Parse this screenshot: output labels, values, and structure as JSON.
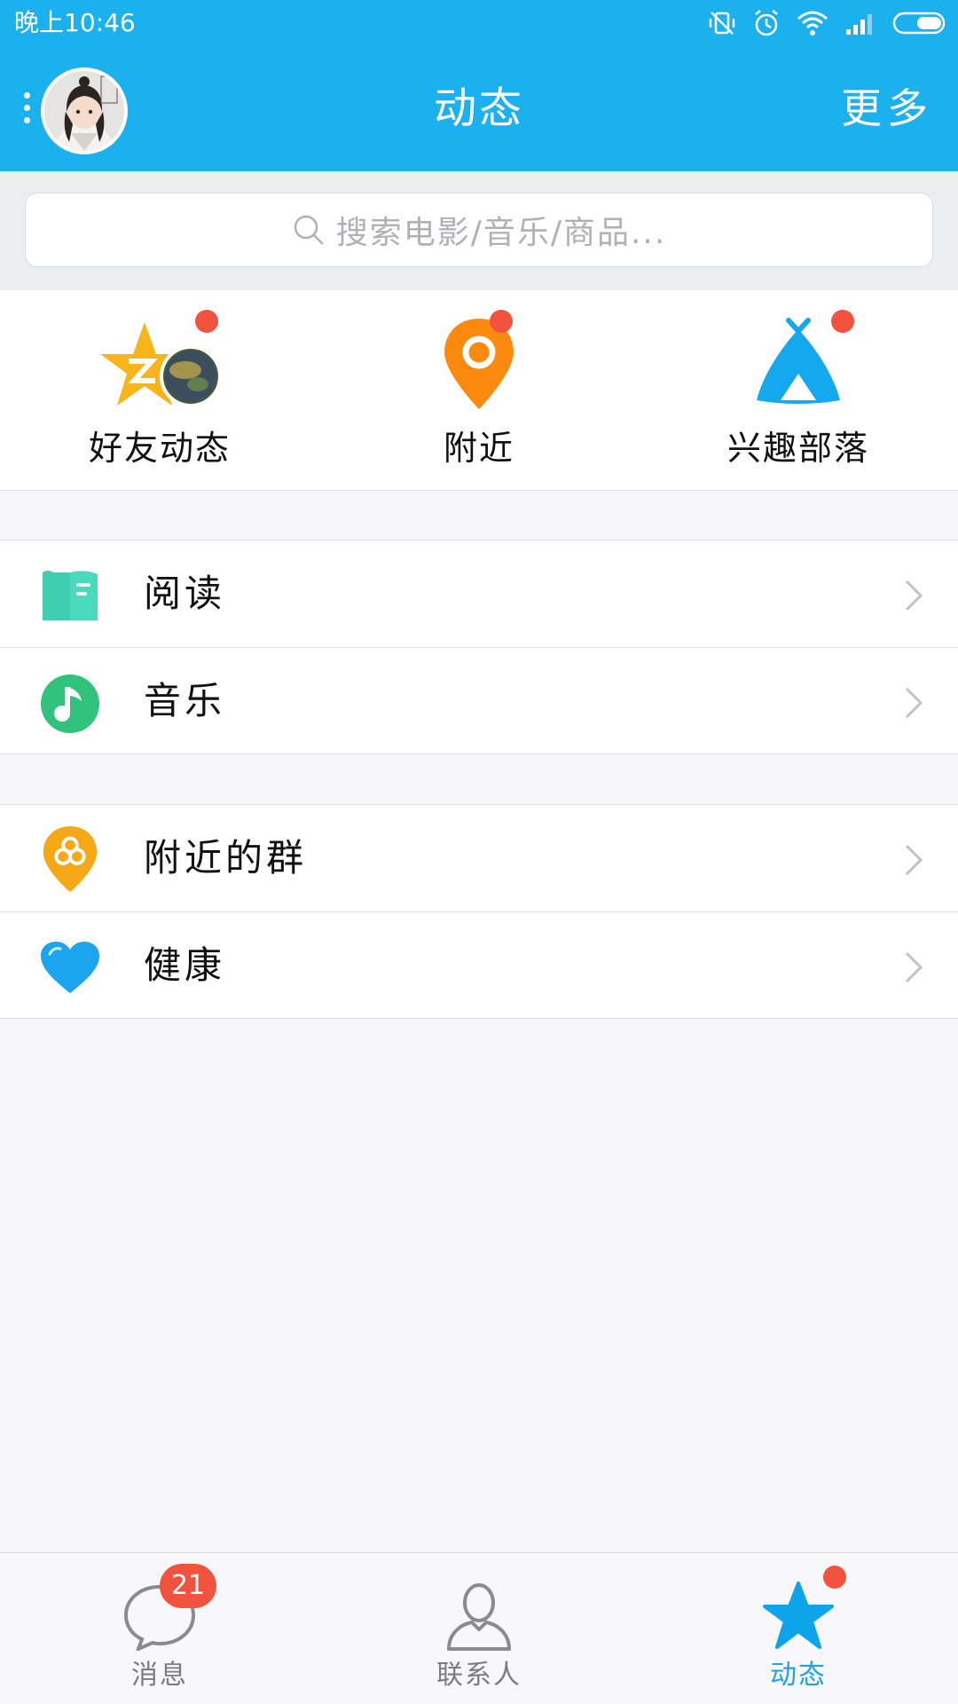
{
  "status_bar": {
    "time": "晚上10:46"
  },
  "header": {
    "title": "动态",
    "more_label": "更多"
  },
  "search": {
    "placeholder": "搜索电影/音乐/商品..."
  },
  "quick_entries": [
    {
      "label": "好友动态",
      "icon": "qzone-star-icon",
      "has_red_dot": true
    },
    {
      "label": "附近",
      "icon": "location-pin-icon",
      "has_red_dot": true
    },
    {
      "label": "兴趣部落",
      "icon": "tent-icon",
      "has_red_dot": true
    }
  ],
  "list_groups": [
    [
      {
        "label": "阅读",
        "icon": "book-icon",
        "color": "#3fcfb0"
      },
      {
        "label": "音乐",
        "icon": "music-note-icon",
        "color": "#31c27c"
      }
    ],
    [
      {
        "label": "附近的群",
        "icon": "nearby-group-icon",
        "color": "#f7a817"
      },
      {
        "label": "健康",
        "icon": "heart-icon",
        "color": "#1aa5ee"
      }
    ]
  ],
  "tab_bar": [
    {
      "label": "消息",
      "icon": "chat-bubble-icon",
      "badge": "21",
      "active": false
    },
    {
      "label": "联系人",
      "icon": "contacts-icon",
      "active": false
    },
    {
      "label": "动态",
      "icon": "star-icon",
      "active": true,
      "has_red_dot": true
    }
  ],
  "colors": {
    "primary": "#1ab1ee",
    "active_tab": "#1ea1e8",
    "red_dot": "#f2533e"
  }
}
